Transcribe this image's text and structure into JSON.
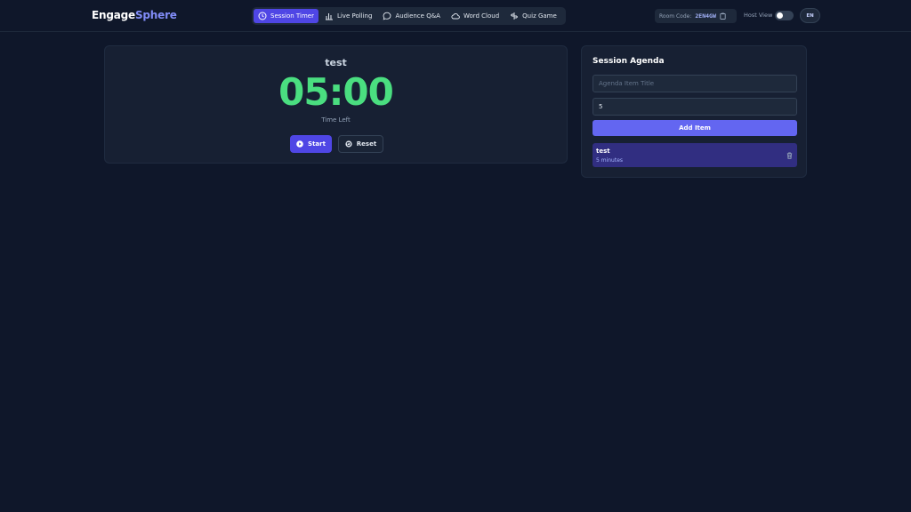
{
  "app": {
    "logo_part1": "Engage",
    "logo_part2": "Sphere"
  },
  "nav": [
    {
      "label": "Session Timer",
      "icon": "clock-icon",
      "active": true
    },
    {
      "label": "Live Polling",
      "icon": "bar-chart-icon",
      "active": false
    },
    {
      "label": "Audience Q&A",
      "icon": "chat-bubble-icon",
      "active": false
    },
    {
      "label": "Word Cloud",
      "icon": "cloud-icon",
      "active": false
    },
    {
      "label": "Quiz Game",
      "icon": "quiz-icon",
      "active": false
    }
  ],
  "header": {
    "room_label": "Room Code:",
    "room_code": "2EN4GW",
    "host_view_label": "Host View",
    "host_view_on": false,
    "language": "EN"
  },
  "timer": {
    "title": "test",
    "value": "05:00",
    "caption": "Time Left",
    "start_label": "Start",
    "reset_label": "Reset"
  },
  "agenda": {
    "title": "Session Agenda",
    "title_placeholder": "Agenda Item Title",
    "minutes_value": "5",
    "add_label": "Add Item",
    "items": [
      {
        "title": "test",
        "duration": "5 minutes"
      }
    ]
  },
  "colors": {
    "background": "#0f172a",
    "accent": "#4f46e5",
    "timer_green": "#4ade80",
    "brand": "#818cf8"
  }
}
